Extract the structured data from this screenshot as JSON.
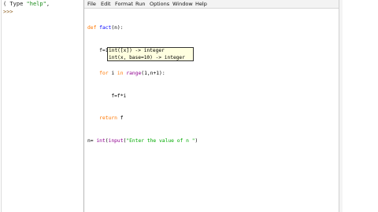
{
  "shell": {
    "line1_prefix": "( Type ",
    "line1_string": "\"help\"",
    "line1_suffix": ",",
    "prompt": ">>>"
  },
  "menubar": {
    "items": [
      "File",
      "Edit",
      "Format",
      "Run",
      "Options",
      "Window",
      "Help"
    ]
  },
  "editor": {
    "line1_kw": "def",
    "line1_name": " fact",
    "line1_rest": "(n):",
    "line2": "    f=1",
    "line3_kw": "    for",
    "line3_mid": " i ",
    "line3_kw2": "in",
    "line3_mid2": " ",
    "line3_builtin": "range",
    "line3_rest": "(1,n+1):",
    "line4": "        f=f*i",
    "line5_kw": "    return",
    "line5_rest": " f",
    "line6_start": "n= ",
    "line6_builtin1": "int",
    "line6_paren": "(",
    "line6_builtin2": "input",
    "line6_paren2": "(",
    "line6_string": "\"Enter the value of n \"",
    "line6_close": ")"
  },
  "calltip": {
    "line1": "int([x]) -> integer",
    "line2": "int(x, base=10) -> integer"
  },
  "colors": {
    "keyword": "#ff7700",
    "definition": "#0000ff",
    "string": "#00aa00",
    "builtin": "#900090",
    "calltip_bg": "#ffffe0"
  }
}
